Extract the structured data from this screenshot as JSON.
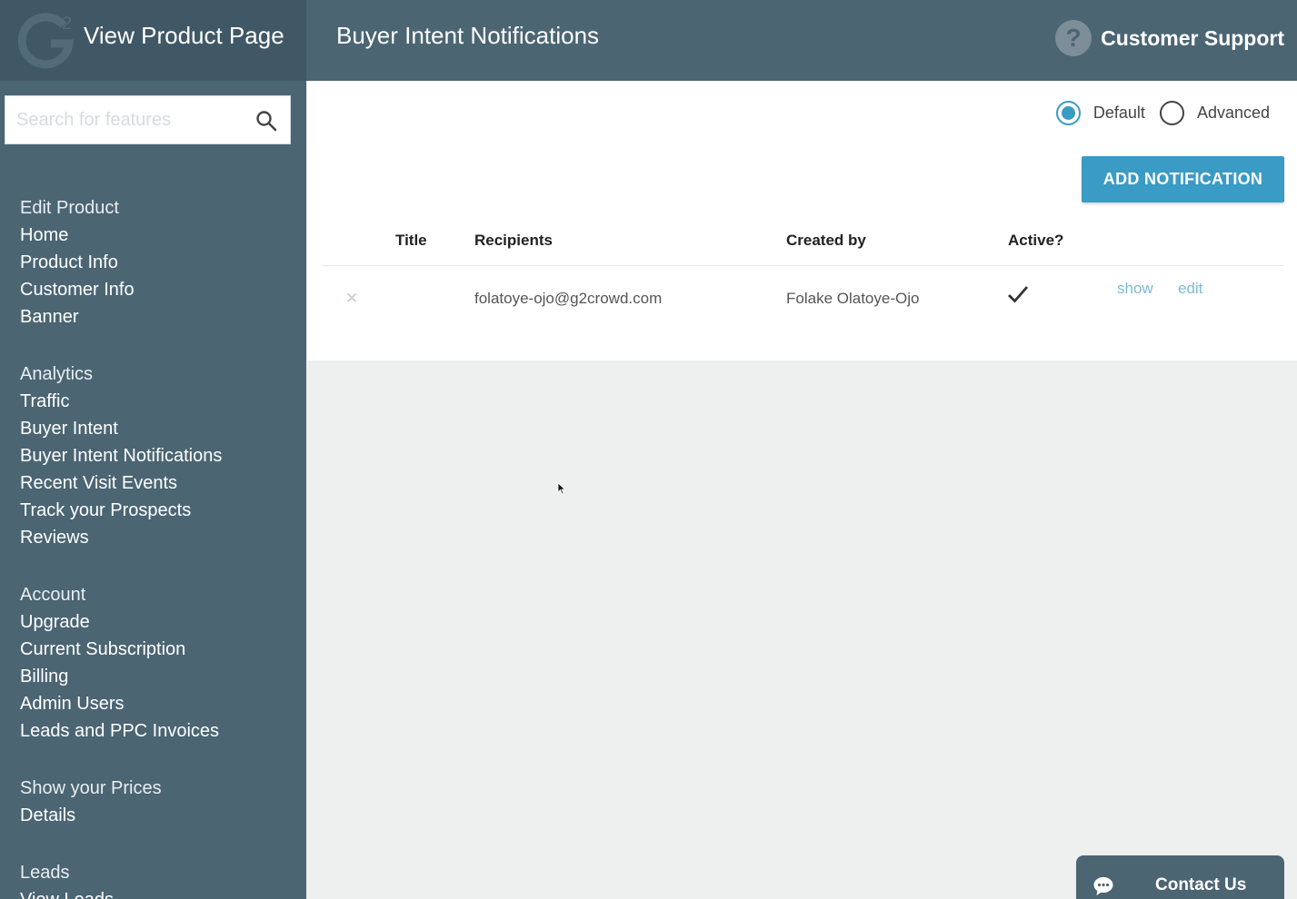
{
  "header": {
    "brand_logo_text": "G2",
    "brand_title": "View Product Page",
    "page_title": "Buyer Intent Notifications",
    "support_label": "Customer Support",
    "support_icon": "question-icon"
  },
  "search": {
    "placeholder": "Search for features",
    "value": "",
    "icon": "search-icon"
  },
  "sidebar": {
    "groups": [
      {
        "heading": "Edit Product",
        "items": [
          "Home",
          "Product Info",
          "Customer Info",
          "Banner"
        ]
      },
      {
        "heading": "Analytics",
        "items": [
          "Traffic",
          "Buyer Intent",
          "Buyer Intent Notifications",
          "Recent Visit Events",
          "Track your Prospects",
          "Reviews"
        ]
      },
      {
        "heading": "Account",
        "items": [
          "Upgrade",
          "Current Subscription",
          "Billing",
          "Admin Users",
          "Leads and PPC Invoices"
        ]
      },
      {
        "heading": "Show your Prices",
        "items": [
          "Details"
        ]
      },
      {
        "heading": "Leads",
        "items": [
          "View Leads"
        ]
      }
    ]
  },
  "mode": {
    "options": [
      "Default",
      "Advanced"
    ],
    "selected": "Default"
  },
  "add_button_label": "ADD NOTIFICATION",
  "table": {
    "columns": [
      "Title",
      "Recipients",
      "Created by",
      "Active?"
    ],
    "rows": [
      {
        "delete_glyph": "✕",
        "title": "",
        "recipients": "folatoye-ojo@g2crowd.com",
        "created_by": "Folake Olatoye-Ojo",
        "active": true,
        "show_label": "show",
        "edit_label": "edit"
      }
    ]
  },
  "contact": {
    "label": "Contact Us",
    "icon": "chat-bubble-icon"
  },
  "colors": {
    "header_bg": "#4b6573",
    "brand_bg": "#405866",
    "accent": "#3a9bc5",
    "link": "#7fb9d4",
    "content_bg": "#eef0ef"
  }
}
